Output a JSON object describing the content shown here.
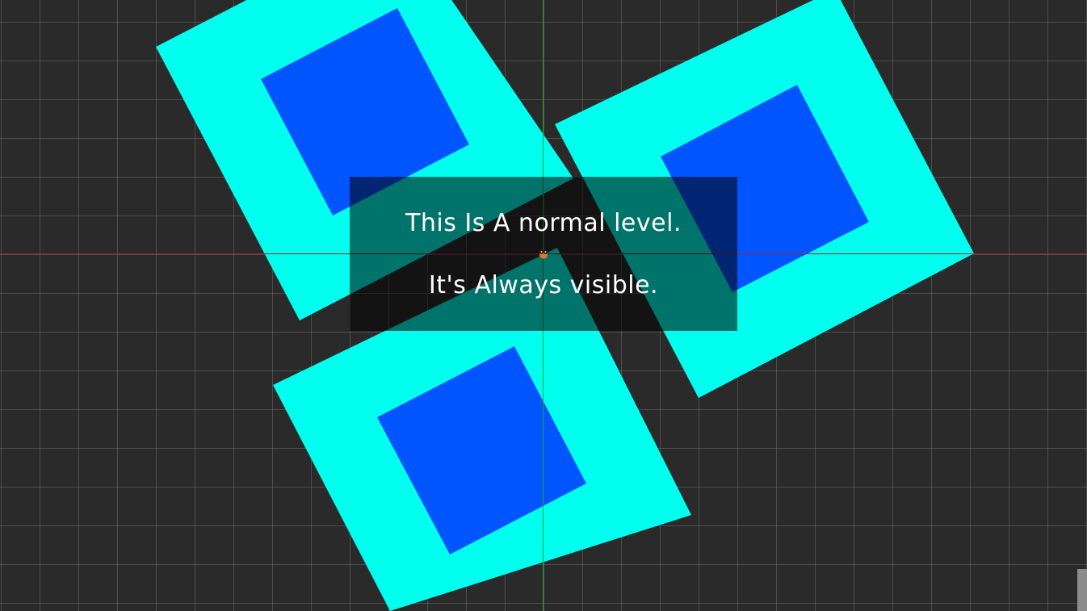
{
  "dialog": {
    "line1": "This Is A normal level.",
    "line2": "It's Always visible."
  },
  "colors": {
    "background": "#2a2a2a",
    "grid": "#5a5a5a",
    "block_outer": "#00ffee",
    "block_inner": "#0055ff",
    "x_axis": "#b22222",
    "y_axis": "#1fa81f",
    "dialog_bg": "rgba(0,0,0,0.55)",
    "text": "#ffffff",
    "player": "#e87722"
  },
  "icons": {
    "player": "player-character-icon"
  }
}
